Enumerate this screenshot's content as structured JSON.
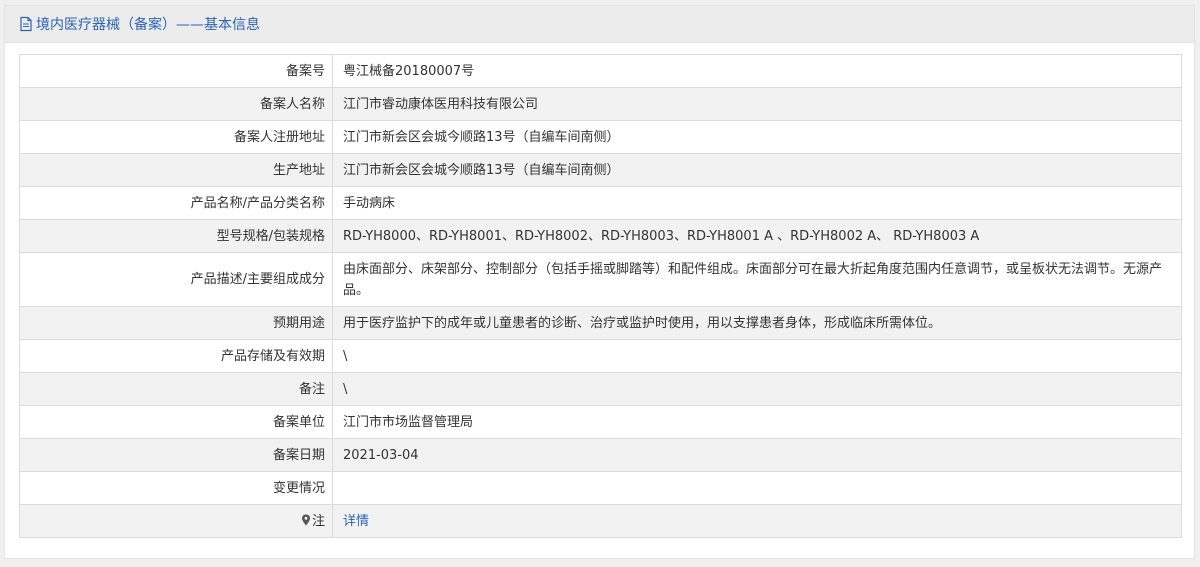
{
  "header": {
    "title": "境内医疗器械（备案）——基本信息",
    "icon": "document-icon"
  },
  "rows": [
    {
      "label": "备案号",
      "value": "粤江械备20180007号"
    },
    {
      "label": "备案人名称",
      "value": "江门市睿动康体医用科技有限公司"
    },
    {
      "label": "备案人注册地址",
      "value": "江门市新会区会城今顺路13号（自编车间南侧）"
    },
    {
      "label": "生产地址",
      "value": "江门市新会区会城今顺路13号（自编车间南侧）"
    },
    {
      "label": "产品名称/产品分类名称",
      "value": "手动病床"
    },
    {
      "label": "型号规格/包装规格",
      "value": "RD-YH8000、RD-YH8001、RD-YH8002、RD-YH8003、RD-YH8001 A 、RD-YH8002 A、 RD-YH8003 A"
    },
    {
      "label": "产品描述/主要组成成分",
      "value": "由床面部分、床架部分、控制部分（包括手摇或脚踏等）和配件组成。床面部分可在最大折起角度范围内任意调节，或呈板状无法调节。无源产品。"
    },
    {
      "label": "预期用途",
      "value": "用于医疗监护下的成年或儿童患者的诊断、治疗或监护时使用，用以支撑患者身体，形成临床所需体位。"
    },
    {
      "label": "产品存储及有效期",
      "value": "\\"
    },
    {
      "label": "备注",
      "value": "\\"
    },
    {
      "label": "备案单位",
      "value": "江门市市场监督管理局"
    },
    {
      "label": "备案日期",
      "value": "2021-03-04"
    },
    {
      "label": "变更情况",
      "value": ""
    }
  ],
  "note_row": {
    "label": "注",
    "icon": "pin-icon",
    "link_text": "详情"
  },
  "colors": {
    "accent": "#2d63b4",
    "header_bg": "#ececec",
    "row_alt_bg": "#f2f2f2",
    "border": "#dcdcdc"
  }
}
